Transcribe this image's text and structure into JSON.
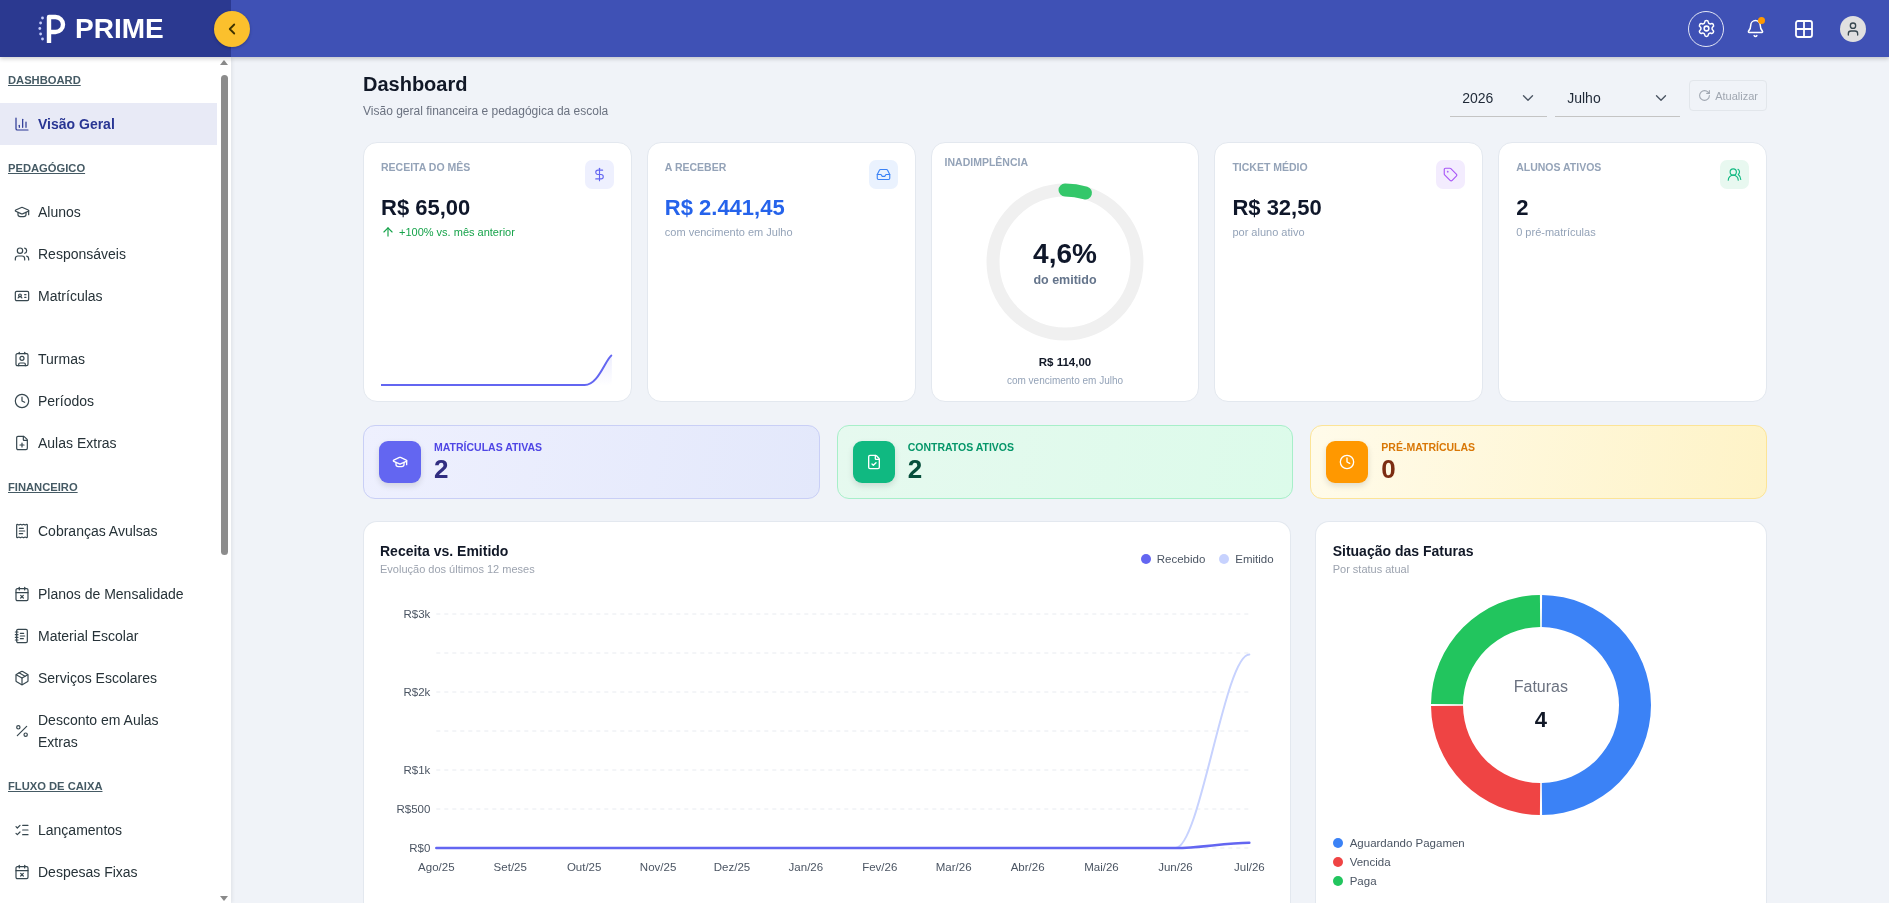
{
  "topbar": {
    "brand": "PRIME",
    "notifications": {
      "unread": true
    }
  },
  "sidebar": {
    "sections": [
      {
        "title": "DASHBOARD",
        "groups": [
          [
            {
              "label": "Visão Geral",
              "selected": true
            }
          ]
        ]
      },
      {
        "title": "PEDAGÓGICO",
        "groups": [
          [
            {
              "label": "Alunos",
              "selected": false
            },
            {
              "label": "Responsáveis",
              "selected": false
            },
            {
              "label": "Matrículas",
              "selected": false
            }
          ],
          [
            {
              "label": "Turmas",
              "selected": false
            },
            {
              "label": "Períodos",
              "selected": false
            },
            {
              "label": "Aulas Extras",
              "selected": false
            }
          ]
        ]
      },
      {
        "title": "FINANCEIRO",
        "groups": [
          [
            {
              "label": "Cobranças Avulsas",
              "selected": false
            }
          ],
          [
            {
              "label": "Planos de Mensalidade",
              "selected": false
            },
            {
              "label": "Material Escolar",
              "selected": false
            },
            {
              "label": "Serviços Escolares",
              "selected": false
            },
            {
              "label": "Desconto em Aulas Extras",
              "selected": false
            }
          ]
        ]
      },
      {
        "title": "FLUXO DE CAIXA",
        "groups": [
          [
            {
              "label": "Lançamentos",
              "selected": false
            },
            {
              "label": "Despesas Fixas",
              "selected": false
            }
          ]
        ]
      }
    ]
  },
  "page": {
    "title": "Dashboard",
    "subtitle": "Visão geral financeira e pedagógica da escola"
  },
  "filters": {
    "year": "2026",
    "month": "Julho",
    "refresh": {
      "label": "Atualizar",
      "disabled": true
    }
  },
  "kpis": [
    {
      "kind": "trend",
      "label": "RECEITA DO MÊS",
      "value": "R$ 65,00",
      "note": "+100% vs. mês anterior",
      "rising": true
    },
    {
      "kind": "highlight",
      "label": "A RECEBER",
      "value": "R$ 2.441,45",
      "note": "com vencimento em Julho"
    },
    {
      "kind": "gauge",
      "label": "INADIMPLÊNCIA",
      "level": 0.046,
      "value": "4,6%",
      "caption": "do emitido",
      "amount": "R$ 114,00",
      "note": "com vencimento em Julho"
    },
    {
      "kind": "plain",
      "label": "TICKET MÉDIO",
      "value": "R$ 32,50",
      "note": "por aluno ativo"
    },
    {
      "kind": "plain",
      "label": "ALUNOS ATIVOS",
      "value": "2",
      "note": "0 pré-matrículas"
    }
  ],
  "banners": [
    {
      "label": "MATRÍCULAS ATIVAS",
      "value": "2",
      "color": "#6366f1"
    },
    {
      "label": "CONTRATOS ATIVOS",
      "value": "2",
      "color": "#10b981"
    },
    {
      "label": "PRÉ-MATRÍCULAS",
      "value": "0",
      "color": "#ff9800"
    }
  ],
  "revenue_chart": {
    "title": "Receita vs. Emitido",
    "subtitle": "Evolução dos últimos 12 meses",
    "legend": [
      {
        "name": "Recebido",
        "color": "#6366f1"
      },
      {
        "name": "Emitido",
        "color": "#c7d2fe"
      }
    ],
    "y_labels": [
      "R$3k",
      "R$2k",
      "R$1k",
      "R$500",
      "R$0"
    ],
    "x_labels": [
      "Ago/25",
      "Set/25",
      "Out/25",
      "Nov/25",
      "Dez/25",
      "Jan/26",
      "Fev/26",
      "Mar/26",
      "Abr/26",
      "Mai/26",
      "Jun/26",
      "Jul/26"
    ]
  },
  "invoices_chart": {
    "subtitle": "Por status atual",
    "center_label": "Faturas",
    "center_value": "4",
    "chart_data": {
      "type": "donut",
      "title": "Situação das Faturas",
      "categories": [
        "Aguardando Pagamen",
        "Vencida",
        "Paga"
      ],
      "values": [
        50,
        25,
        25
      ],
      "colors": [
        "#3b82f6",
        "#ef4444",
        "#22c55e"
      ]
    }
  }
}
